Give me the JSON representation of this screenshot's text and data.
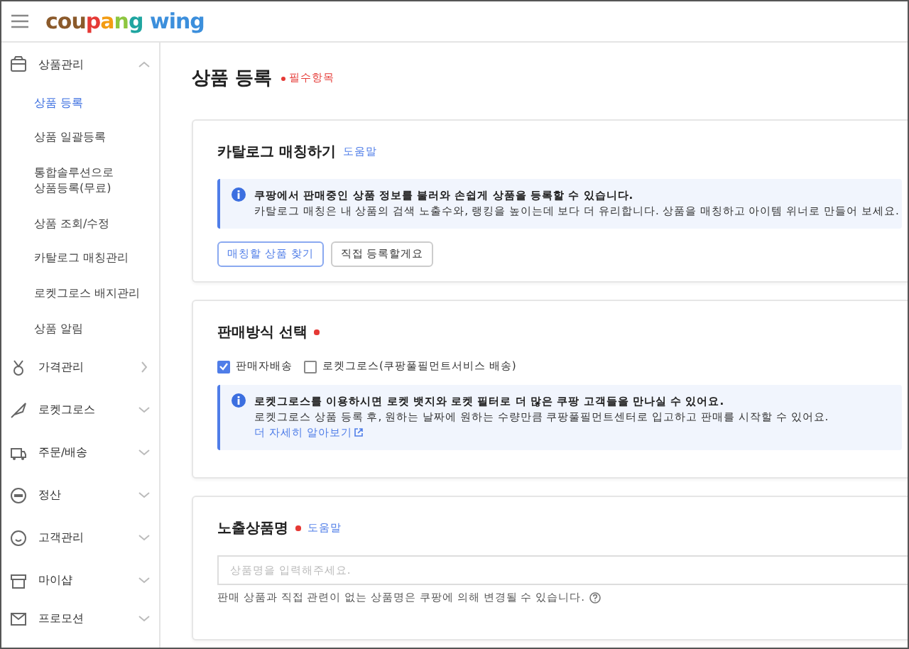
{
  "header": {
    "logo": "coupang wing"
  },
  "sidebar": {
    "groups": [
      {
        "label": "상품관리",
        "kind": "menu",
        "expanded": true,
        "children": [
          {
            "label": "상품 등록",
            "selected": true
          },
          {
            "label": "상품 일괄등록",
            "selected": false
          },
          {
            "label": "통합솔루션으로 상품등록(무료)",
            "selected": false
          },
          {
            "label": "상품 조회/수정",
            "selected": false
          },
          {
            "label": "카탈로그 매칭관리",
            "selected": false
          },
          {
            "label": "로켓그로스 배지관리",
            "selected": false
          },
          {
            "label": "상품 알림",
            "selected": false
          }
        ]
      },
      {
        "label": "가격관리",
        "kind": "link"
      },
      {
        "label": "로켓그로스",
        "kind": "menu",
        "expanded": false
      },
      {
        "label": "주문/배송",
        "kind": "menu",
        "expanded": false
      },
      {
        "label": "정산",
        "kind": "menu",
        "expanded": false
      },
      {
        "label": "고객관리",
        "kind": "menu",
        "expanded": false
      },
      {
        "label": "마이샵",
        "kind": "menu",
        "expanded": false
      },
      {
        "label": "프로모션",
        "kind": "menu",
        "expanded": false
      }
    ]
  },
  "page": {
    "title": "상품 등록",
    "required_note": "필수항목"
  },
  "sections": [
    {
      "title": "카탈로그 매칭하기",
      "required": false,
      "help": "도움말",
      "notice": {
        "heading": "쿠팡에서 판매중인 상품 정보를 불러와 손쉽게 상품을 등록할 수 있습니다.",
        "text": "카탈로그 매칭은 내 상품의 검색 노출수와, 랭킹을 높이는데 보다 더 유리합니다. 상품을 매칭하고 아이템 위너로 만들어 보세요."
      },
      "buttons": [
        {
          "label": "매칭할 상품 찾기",
          "kind": "primary"
        },
        {
          "label": "직접 등록할게요",
          "kind": "default"
        }
      ]
    },
    {
      "title": "판매방식 선택",
      "required": true,
      "checkboxes": [
        {
          "label": "판매자배송",
          "checked": true
        },
        {
          "label": "로켓그로스(쿠팡풀필먼트서비스 배송)",
          "checked": false
        }
      ],
      "notice": {
        "heading": "로켓그로스를 이용하시면 로켓 뱃지와 로켓 필터로 더 많은 쿠팡 고객들을 만나실 수 있어요.",
        "text": "로켓그로스 상품 등록 후, 원하는 날짜에 원하는 수량만큼 쿠팡풀필먼트센터로 입고하고 판매를 시작할 수 있어요.",
        "link": "더 자세히 알아보기"
      }
    },
    {
      "title": "노출상품명",
      "required": true,
      "help": "도움말",
      "input": {
        "placeholder": "상품명을 입력해주세요."
      },
      "hint": "판매 상품과 직접 관련이 없는 상품명은 쿠팡에 의해 변경될 수 있습니다."
    }
  ]
}
